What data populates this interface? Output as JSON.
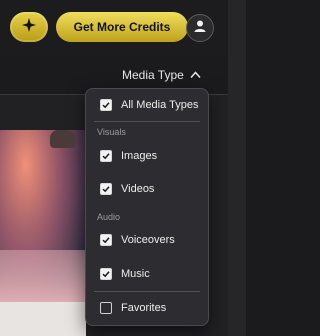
{
  "header": {
    "credits_label": "Get More Credits",
    "icons": {
      "spark": "sparkle-icon",
      "account": "user-icon"
    }
  },
  "filter": {
    "label": "Media Type",
    "chevron": "chevron-up-icon"
  },
  "dropdown": {
    "all_label": "All Media Types",
    "sections": {
      "visuals": "Visuals",
      "audio": "Audio"
    },
    "items": {
      "images": {
        "label": "Images",
        "checked": true
      },
      "videos": {
        "label": "Videos",
        "checked": true
      },
      "voiceovers": {
        "label": "Voiceovers",
        "checked": true
      },
      "music": {
        "label": "Music",
        "checked": true
      },
      "favorites": {
        "label": "Favorites",
        "checked": false
      }
    }
  },
  "colors": {
    "accent_gold": "#e2cc3f",
    "background": "#1b1b1d",
    "dropdown_bg": "#2e2e32"
  }
}
